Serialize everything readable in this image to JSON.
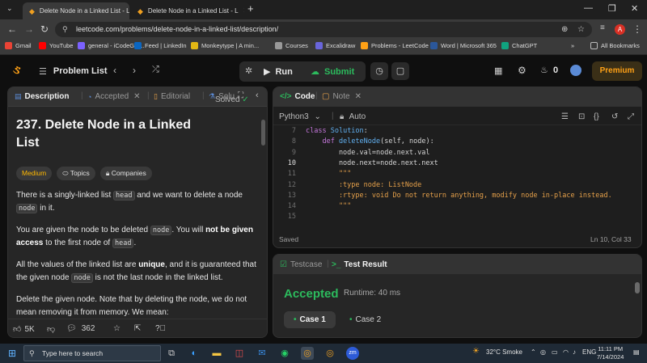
{
  "browser": {
    "tabs": [
      {
        "title": "Delete Node in a Linked List - L",
        "active": true
      },
      {
        "title": "Delete Node in a Linked List - L",
        "active": false
      }
    ],
    "new_tab_label": "+",
    "url": "leetcode.com/problems/delete-node-in-a-linked-list/description/",
    "profile_initial": "A",
    "bookmarks": [
      {
        "label": "Gmail",
        "color": "#ea4335"
      },
      {
        "label": "YouTube",
        "color": "#ff0000"
      },
      {
        "label": "general - iCodeGur...",
        "color": "#7b61ff"
      },
      {
        "label": "Feed | LinkedIn",
        "color": "#0a66c2"
      },
      {
        "label": "Monkeytype | A min...",
        "color": "#e2b714"
      },
      {
        "label": "Courses",
        "color": "#999999"
      },
      {
        "label": "Excalidraw",
        "color": "#6965db"
      },
      {
        "label": "Problems - LeetCode",
        "color": "#ffa116"
      },
      {
        "label": "Word | Microsoft 365",
        "color": "#2b579a"
      },
      {
        "label": "ChatGPT",
        "color": "#10a37f"
      }
    ],
    "more_bookmarks": "»",
    "all_bookmarks": "All Bookmarks"
  },
  "header": {
    "problem_list": "Problem List",
    "run": "Run",
    "submit": "Submit",
    "streak": "0",
    "premium": "Premium"
  },
  "left": {
    "tabs": {
      "description": "Description",
      "accepted": "Accepted",
      "editorial": "Editorial",
      "solutions": "Solu"
    },
    "title": "237. Delete Node in a Linked List",
    "solved": "Solved",
    "chips": {
      "difficulty": "Medium",
      "topics": "Topics",
      "companies": "Companies"
    },
    "p1": {
      "a": "There is a singly-linked list ",
      "code1": "head",
      "b": " and we want to delete a node ",
      "code2": "node",
      "c": " in it."
    },
    "p2": {
      "a": "You are given the node to be deleted ",
      "code1": "node",
      "b": ". You will ",
      "bold": "not be given access",
      "c": " to the first node of ",
      "code2": "head",
      "d": "."
    },
    "p3": {
      "a": "All the values of the linked list are ",
      "bold": "unique",
      "b": ", and it is guaranteed that the given node ",
      "code1": "node",
      "c": " is not the last node in the linked list."
    },
    "p4": {
      "a": "Delete the given node. Note that by deleting the node, we do not mean removing it from memory. We mean:"
    },
    "footer": {
      "likes": "5K",
      "comments": "362"
    }
  },
  "code": {
    "tabs": {
      "code": "Code",
      "note": "Note"
    },
    "language": "Python3",
    "auto": "Auto",
    "lines": [
      {
        "n": "7",
        "parts": [
          [
            "kw",
            "class "
          ],
          [
            "kb",
            "Solution"
          ],
          [
            "tx",
            ":"
          ]
        ]
      },
      {
        "n": "8",
        "parts": [
          [
            "tx",
            "    "
          ],
          [
            "kw",
            "def "
          ],
          [
            "kb",
            "deleteNode"
          ],
          [
            "tx",
            "(self, node):"
          ]
        ]
      },
      {
        "n": "9",
        "parts": [
          [
            "tx",
            "        node.val=node.next.val"
          ]
        ]
      },
      {
        "n": "10",
        "parts": [
          [
            "tx",
            "        node.next=node.next.next"
          ]
        ]
      },
      {
        "n": "11",
        "parts": [
          [
            "cm",
            "        \"\"\""
          ]
        ]
      },
      {
        "n": "12",
        "parts": [
          [
            "cm",
            "        :type node: ListNode"
          ]
        ]
      },
      {
        "n": "13",
        "parts": [
          [
            "cm",
            "        :rtype: void Do not return anything, modify node in-place instead."
          ]
        ]
      },
      {
        "n": "14",
        "parts": [
          [
            "cm",
            "        \"\"\""
          ]
        ]
      },
      {
        "n": "15",
        "parts": [
          [
            "tx",
            ""
          ]
        ]
      }
    ],
    "current_line": "10",
    "status_left": "Saved",
    "status_right": "Ln 10, Col 33"
  },
  "test": {
    "tabs": {
      "testcase": "Testcase",
      "result": "Test Result"
    },
    "verdict": "Accepted",
    "runtime": "Runtime: 40 ms",
    "cases": [
      "Case 1",
      "Case 2"
    ]
  },
  "taskbar": {
    "search_placeholder": "Type here to search",
    "weather": "32°C  Smoke",
    "time": "11:11 PM",
    "date": "7/14/2024"
  }
}
